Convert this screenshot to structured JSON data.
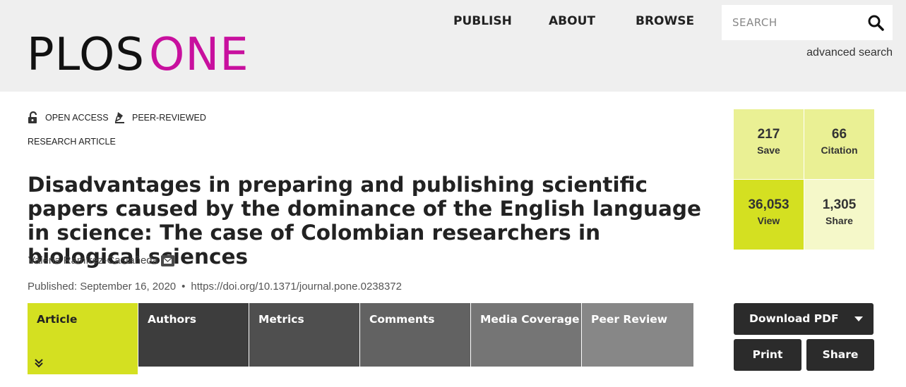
{
  "header": {
    "logo_primary": "PLOS",
    "logo_secondary": "ONE",
    "brand_color": "#c8109e",
    "nav": {
      "publish": "PUBLISH",
      "about": "ABOUT",
      "browse": "BROWSE"
    },
    "search": {
      "placeholder": "SEARCH",
      "icon": "search-icon"
    },
    "advanced_search": "advanced search"
  },
  "article": {
    "badges": {
      "open_access": "OPEN ACCESS",
      "peer_reviewed": "PEER-REVIEWED"
    },
    "type": "RESEARCH ARTICLE",
    "title": "Disadvantages in preparing and publishing scientific papers caused by the dominance of the English language in science: The case of Colombian researchers in biological sciences",
    "author": "Valeria Ramírez-Castañeda",
    "published": "Published: September 16, 2020",
    "doi": "https://doi.org/10.1371/journal.pone.0238372",
    "tabs": [
      {
        "label": "Article",
        "active": true
      },
      {
        "label": "Authors"
      },
      {
        "label": "Metrics"
      },
      {
        "label": "Comments"
      },
      {
        "label": "Media Coverage"
      },
      {
        "label": "Peer Review"
      }
    ],
    "tab_colors": [
      "#d4e021",
      "#3d3d3d",
      "#4f4f4f",
      "#626262",
      "#757575",
      "#878787"
    ]
  },
  "metrics": [
    {
      "value": "217",
      "label": "Save",
      "color": "#eaf094"
    },
    {
      "value": "66",
      "label": "Citation",
      "color": "#eaf094"
    },
    {
      "value": "36,053",
      "label": "View",
      "color": "#d4e021"
    },
    {
      "value": "1,305",
      "label": "Share",
      "color": "#f5f8c9"
    }
  ],
  "actions": {
    "download": "Download PDF",
    "print": "Print",
    "share": "Share"
  }
}
